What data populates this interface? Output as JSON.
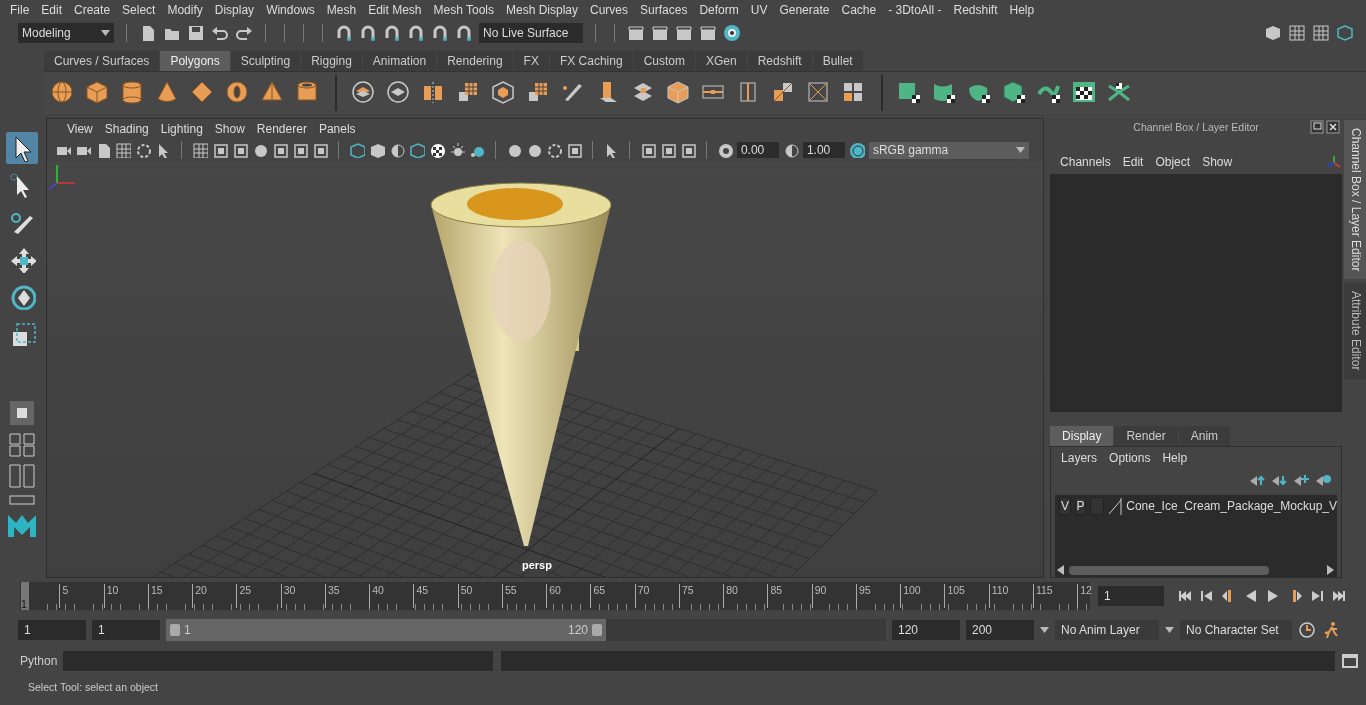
{
  "menu_bar": [
    "File",
    "Edit",
    "Create",
    "Select",
    "Modify",
    "Display",
    "Windows",
    "Mesh",
    "Edit Mesh",
    "Mesh Tools",
    "Mesh Display",
    "Curves",
    "Surfaces",
    "Deform",
    "UV",
    "Generate",
    "Cache",
    "- 3DtoAll -",
    "Redshift",
    "Help"
  ],
  "status_line": {
    "workspace": "Modeling",
    "live_surface": "No Live Surface"
  },
  "shelf": {
    "tabs": [
      {
        "label": "Curves / Surfaces",
        "selected": false
      },
      {
        "label": "Polygons",
        "selected": true
      },
      {
        "label": "Sculpting",
        "selected": false
      },
      {
        "label": "Rigging",
        "selected": false
      },
      {
        "label": "Animation",
        "selected": false
      },
      {
        "label": "Rendering",
        "selected": false
      },
      {
        "label": "FX",
        "selected": false
      },
      {
        "label": "FX Caching",
        "selected": false
      },
      {
        "label": "Custom",
        "selected": false
      },
      {
        "label": "XGen",
        "selected": false
      },
      {
        "label": "Redshift",
        "selected": false
      },
      {
        "label": "Bullet",
        "selected": false
      }
    ]
  },
  "toolbox": {
    "tools": [
      {
        "kind": "select",
        "selected": true
      },
      {
        "kind": "lasso",
        "selected": false
      },
      {
        "kind": "paint",
        "selected": false
      },
      {
        "kind": "move",
        "selected": false
      },
      {
        "kind": "rotate",
        "selected": false
      },
      {
        "kind": "scale",
        "selected": false
      }
    ]
  },
  "viewport": {
    "menus": [
      "View",
      "Shading",
      "Lighting",
      "Show",
      "Renderer",
      "Panels"
    ],
    "exposure": "0.00",
    "gamma": "1.00",
    "color_space": "sRGB gamma",
    "camera": "persp"
  },
  "channel_box": {
    "title": "Channel Box / Layer Editor",
    "menus": [
      "Channels",
      "Edit",
      "Object",
      "Show"
    ]
  },
  "layer_editor": {
    "tabs": [
      {
        "label": "Display",
        "selected": true
      },
      {
        "label": "Render",
        "selected": false
      },
      {
        "label": "Anim",
        "selected": false
      }
    ],
    "menus": [
      "Layers",
      "Options",
      "Help"
    ],
    "layers": [
      {
        "visibility": "V",
        "playback": "P",
        "name": "Cone_Ice_Cream_Package_Mockup_V"
      }
    ]
  },
  "side_tabs": [
    {
      "label": "Channel Box / Layer Editor",
      "selected": true
    },
    {
      "label": "Attribute Editor",
      "selected": false
    }
  ],
  "time_slider": {
    "current_frame": "1",
    "level": 0,
    "ticks": [
      "5",
      "10",
      "15",
      "20",
      "25",
      "30",
      "35",
      "40",
      "45",
      "50",
      "55",
      "60",
      "65",
      "70",
      "75",
      "80",
      "85",
      "90",
      "95",
      "100",
      "105",
      "110",
      "115",
      "12"
    ],
    "frame_field": "1"
  },
  "range_slider": {
    "start": "1",
    "playback_start": "1",
    "range_start": "1",
    "range_end": "120",
    "playback_end": "120",
    "end": "200",
    "anim_layer": "No Anim Layer",
    "character_set": "No Character Set"
  },
  "command_line": {
    "language": "Python"
  },
  "help_line": "Select Tool: select an object"
}
